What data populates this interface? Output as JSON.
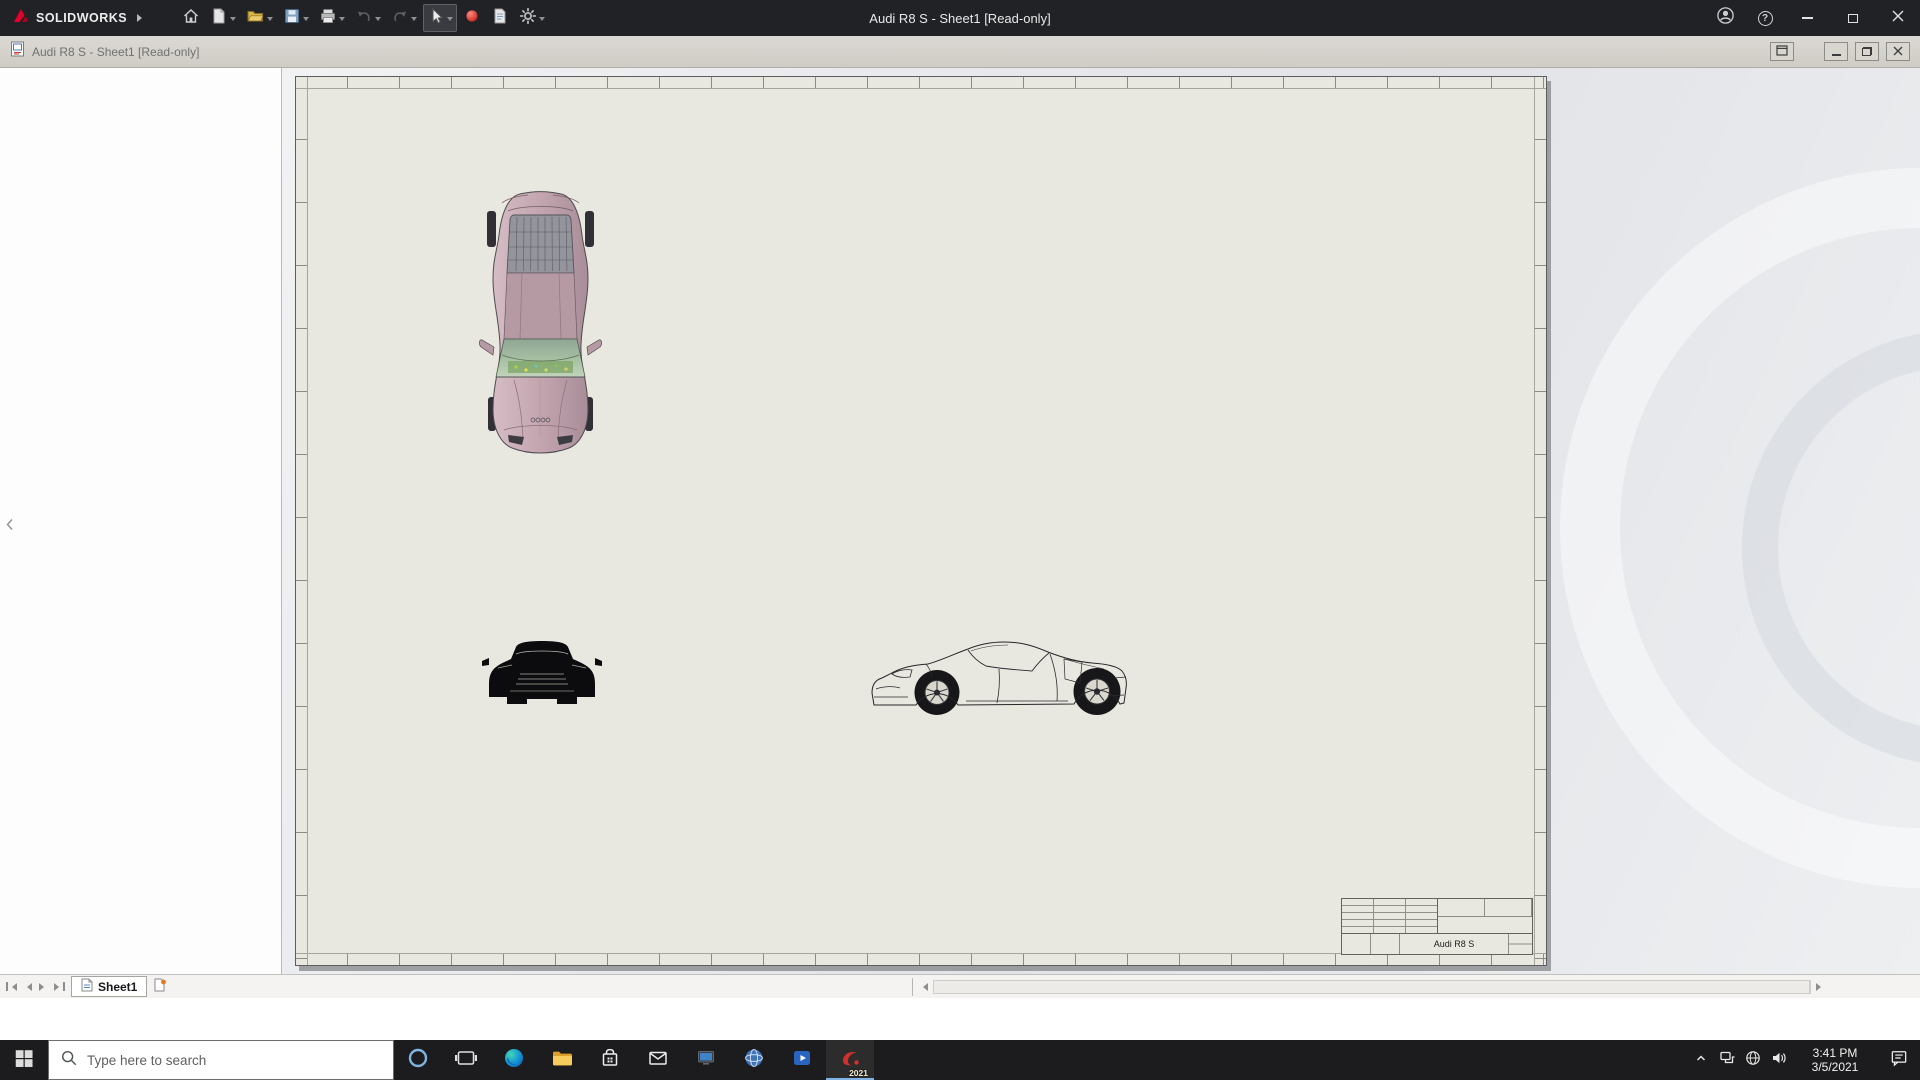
{
  "app": {
    "brand": "SOLIDWORKS",
    "title": "Audi R8 S - Sheet1 [Read-only]"
  },
  "doc_window": {
    "title": "Audi R8 S - Sheet1 [Read-only]"
  },
  "statusbar": {
    "sheet_tab": "Sheet1"
  },
  "title_block": {
    "part_name": "Audi R8 S"
  },
  "taskbar": {
    "search_placeholder": "Type here to search",
    "solidworks_badge": "2021",
    "time": "3:41 PM",
    "date": "3/5/2021"
  },
  "icons": {
    "help": "?",
    "caret-down": "▾",
    "scroll-left": "◂",
    "scroll-right": "▸",
    "chevron-up": "^"
  },
  "colors": {
    "brand_red": "#e4002b",
    "titlebar_bg": "#212226",
    "sheet_bg": "#e9e8e0",
    "taskbar_bg": "#1c1c1e",
    "car_body_pink": "#c3a5af"
  }
}
